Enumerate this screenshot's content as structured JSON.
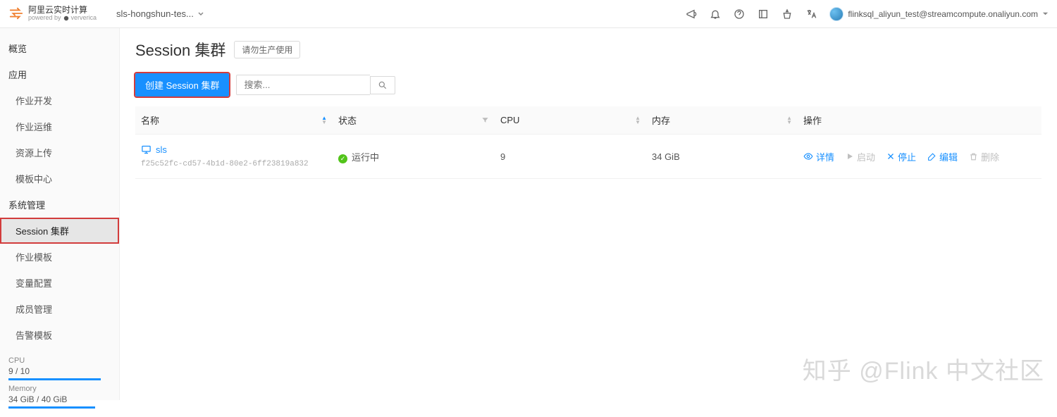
{
  "header": {
    "logo_title": "阿里云实时计算",
    "logo_subtitle": "powered by",
    "logo_brand": "ververica",
    "workspace": "sls-hongshun-tes...",
    "user_email": "flinksql_aliyun_test@streamcompute.onaliyun.com"
  },
  "sidebar": {
    "overview": "概览",
    "section_app": "应用",
    "app_items": [
      "作业开发",
      "作业运维",
      "资源上传",
      "模板中心"
    ],
    "section_sys": "系统管理",
    "sys_items": [
      "Session 集群",
      "作业模板",
      "变量配置",
      "成员管理",
      "告警模板"
    ],
    "active_index": 0,
    "usage": {
      "cpu_label": "CPU",
      "cpu_value": "9 / 10",
      "mem_label": "Memory",
      "mem_value": "34 GiB / 40 GiB"
    }
  },
  "page": {
    "title": "Session 集群",
    "tag": "请勿生产使用",
    "create_btn": "创建 Session 集群",
    "search_placeholder": "搜索..."
  },
  "table": {
    "cols": {
      "name": "名称",
      "status": "状态",
      "cpu": "CPU",
      "mem": "内存",
      "ops": "操作"
    },
    "row": {
      "name": "sls",
      "id": "f25c52fc-cd57-4b1d-80e2-6ff23819a832",
      "status": "运行中",
      "cpu": "9",
      "mem": "34 GiB",
      "actions": {
        "detail": "详情",
        "start": "启动",
        "stop": "停止",
        "edit": "编辑",
        "delete": "删除"
      }
    }
  },
  "watermark": "知乎 @Flink 中文社区"
}
